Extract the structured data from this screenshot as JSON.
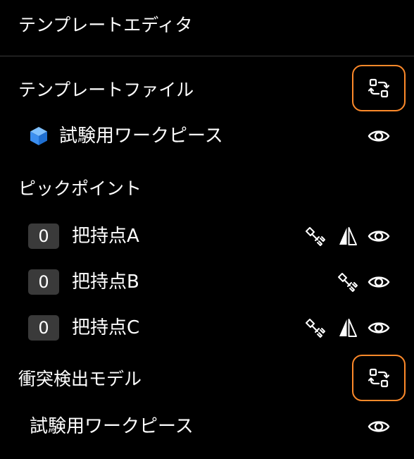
{
  "panel": {
    "title": "テンプレートエディタ"
  },
  "template_file": {
    "title": "テンプレートファイル",
    "swap_icon": "swap-icon",
    "item": {
      "label": "試験用ワークピース",
      "icon": "cube-icon",
      "visibility_icon": "eye-icon"
    }
  },
  "pick_points": {
    "title": "ピックポイント",
    "items": [
      {
        "count": "0",
        "label": "把持点A",
        "icons": [
          "gripper-icon",
          "mirror-icon",
          "eye-icon"
        ]
      },
      {
        "count": "0",
        "label": "把持点B",
        "icons": [
          "gripper-icon",
          "eye-icon"
        ]
      },
      {
        "count": "0",
        "label": "把持点C",
        "icons": [
          "gripper-icon",
          "mirror-icon",
          "eye-icon"
        ]
      }
    ]
  },
  "collision_model": {
    "title": "衝突検出モデル",
    "swap_icon": "swap-icon",
    "item": {
      "label": "試験用ワークピース",
      "visibility_icon": "eye-icon"
    }
  },
  "colors": {
    "background": "#000000",
    "text": "#ffffff",
    "accent_border": "#ff8a2a",
    "badge_bg": "#3a3a3a",
    "cube": "#3b8ef0"
  }
}
